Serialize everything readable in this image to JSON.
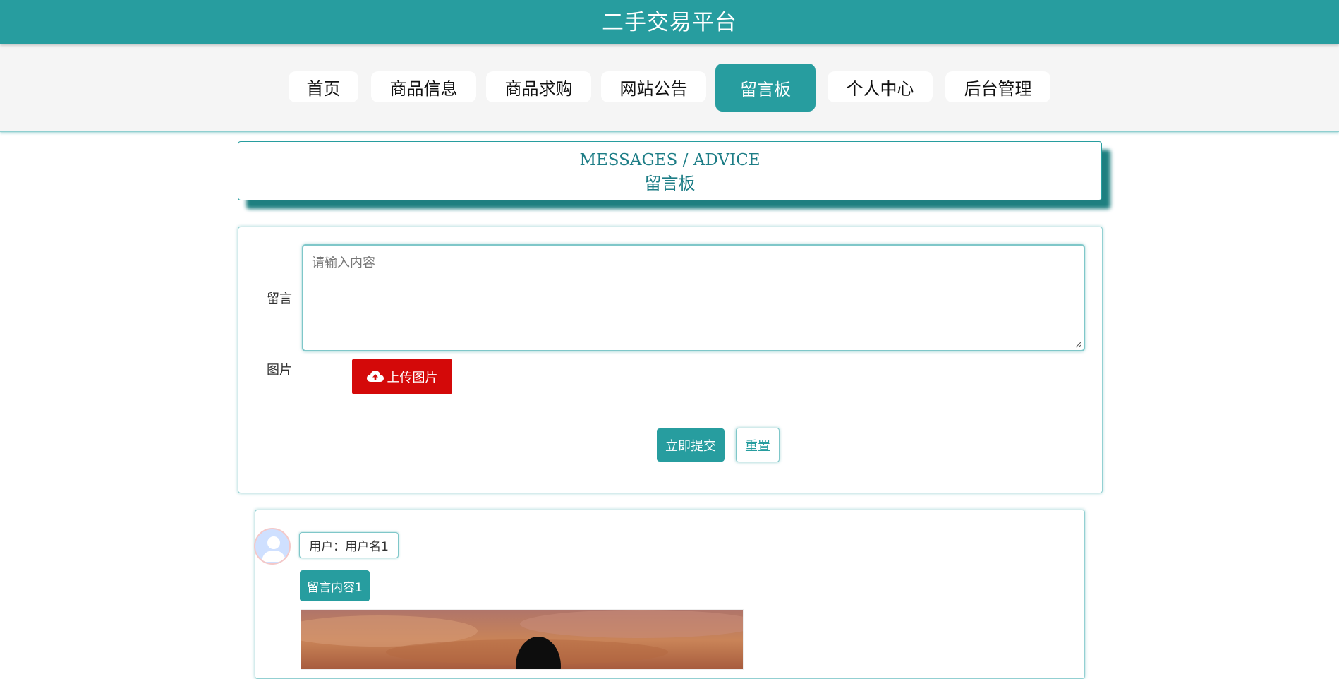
{
  "header": {
    "title": "二手交易平台"
  },
  "nav": {
    "items": [
      {
        "label": "首页"
      },
      {
        "label": "商品信息"
      },
      {
        "label": "商品求购"
      },
      {
        "label": "网站公告"
      },
      {
        "label": "留言板",
        "active": true
      },
      {
        "label": "个人中心"
      },
      {
        "label": "后台管理"
      }
    ]
  },
  "page_title": {
    "english": "MESSAGES / ADVICE",
    "chinese": "留言板"
  },
  "form": {
    "message_label": "留言",
    "message_placeholder": "请输入内容",
    "image_label": "图片",
    "upload_label": "上传图片",
    "upload_icon": "cloud-upload-icon",
    "submit_label": "立即提交",
    "reset_label": "重置"
  },
  "messages": [
    {
      "user_text": "用户：用户名1",
      "content": "留言内容1",
      "avatar_icon": "user-avatar-icon"
    }
  ],
  "colors": {
    "accent": "#279d9f",
    "upload_button": "#d40909",
    "title_text": "#1d7d86"
  }
}
